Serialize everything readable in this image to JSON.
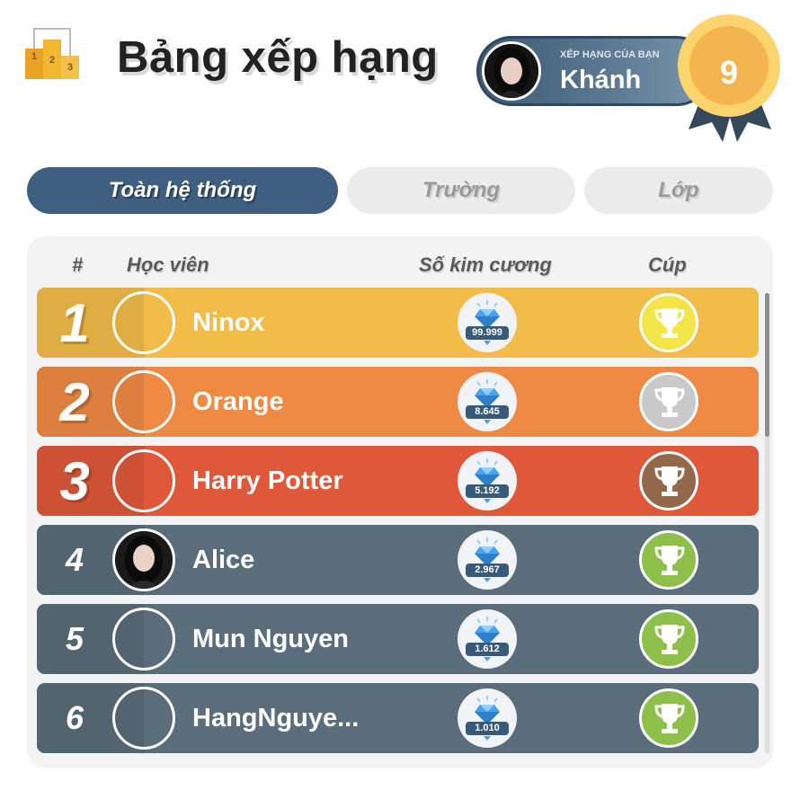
{
  "header": {
    "title": "Bảng xếp hạng",
    "icon": "podium-icon",
    "podium_numbers": [
      "1",
      "2",
      "3"
    ],
    "my_rank": {
      "caption": "XẾP HẠNG CỦA BẠN",
      "name": "Khánh",
      "rank": "9"
    }
  },
  "tabs": [
    {
      "label": "Toàn hệ thống",
      "active": true
    },
    {
      "label": "Trường",
      "active": false
    },
    {
      "label": "Lớp",
      "active": false
    }
  ],
  "table": {
    "columns": [
      "#",
      "Học viên",
      "Số kim cương",
      "Cúp"
    ],
    "rows": [
      {
        "rank": "1",
        "name": "Ninox",
        "diamonds": "99.999",
        "cup": "gold",
        "color": "#f2bc49",
        "has_photo": false
      },
      {
        "rank": "2",
        "name": "Orange",
        "diamonds": "8.645",
        "cup": "silver",
        "color": "#ef8a45",
        "has_photo": false
      },
      {
        "rank": "3",
        "name": "Harry Potter",
        "diamonds": "5.192",
        "cup": "bronze",
        "color": "#df583a",
        "has_photo": false
      },
      {
        "rank": "4",
        "name": "Alice",
        "diamonds": "2.967",
        "cup": "green",
        "color": "#5a6d7b",
        "has_photo": true
      },
      {
        "rank": "5",
        "name": "Mun Nguyen",
        "diamonds": "1.612",
        "cup": "green",
        "color": "#5a6d7b",
        "has_photo": false
      },
      {
        "rank": "6",
        "name": "HangNguye...",
        "diamonds": "1.010",
        "cup": "green",
        "color": "#5a6d7b",
        "has_photo": false
      }
    ]
  },
  "colors": {
    "accent": "#3e5f7f",
    "gold_cup": "#f2e449",
    "silver_cup": "#c9c9c9",
    "bronze_cup": "#94694b",
    "green_cup": "#8dbf4a",
    "medal": "#f7bd54"
  }
}
